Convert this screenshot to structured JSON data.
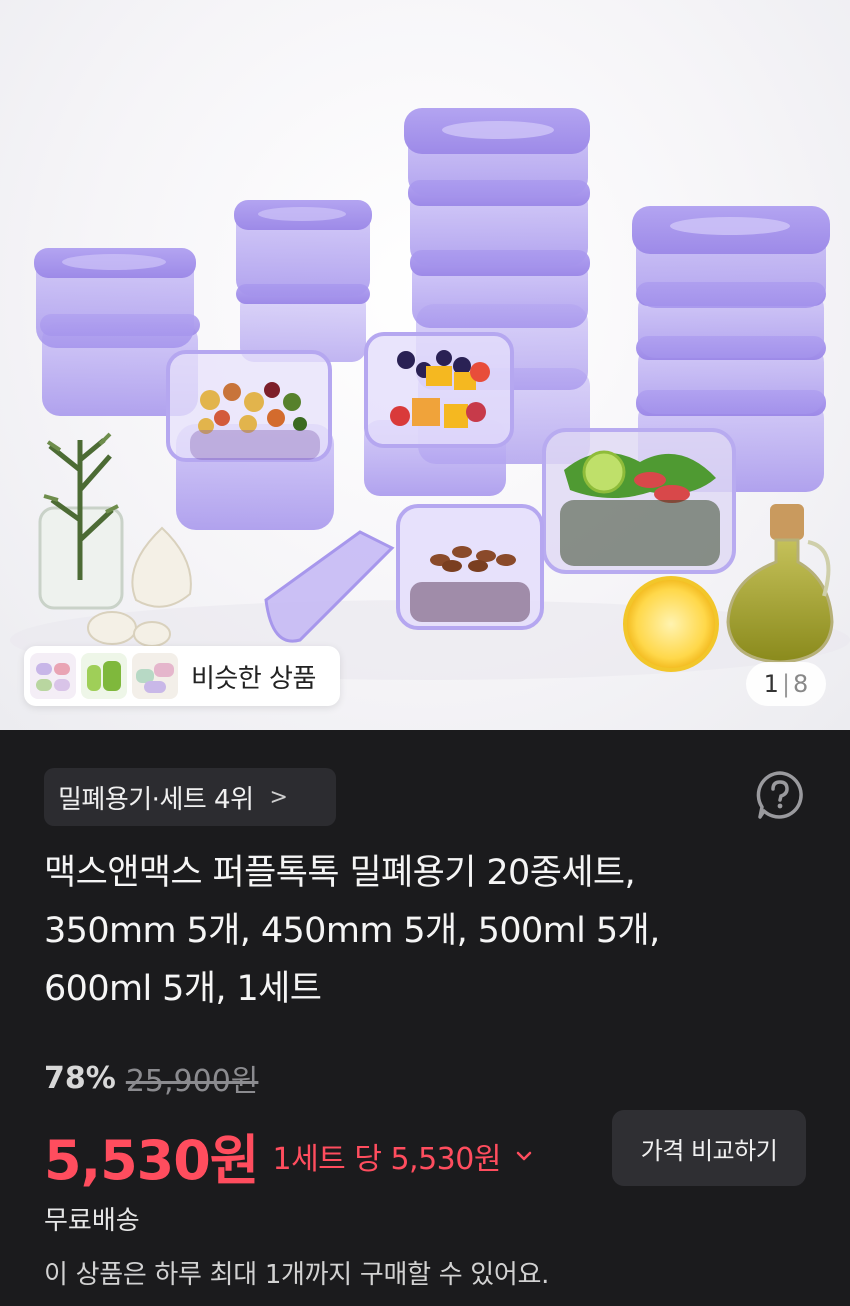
{
  "product_image": {
    "alt": "맥스앤맥스 퍼플톡톡 밀폐용기 20종세트",
    "similar_products": {
      "label": "비슷한 상품",
      "thumbnails": [
        "similar-product-1",
        "similar-product-2",
        "similar-product-3"
      ]
    },
    "page_counter": {
      "current": "1",
      "total": "8"
    }
  },
  "ranking": {
    "label": "밀폐용기·세트 4위",
    "chevron": ">"
  },
  "help_icon": "question-mark-icon",
  "product": {
    "title_lines": [
      "맥스앤맥스 퍼플톡톡 밀폐용기 20종세트,",
      "350mm 5개, 450mm 5개, 500ml 5개,",
      "600ml 5개, 1세트"
    ]
  },
  "pricing": {
    "discount_rate": "78%",
    "original_price": "25,900원",
    "sale_price": "5,530원",
    "unit_price": "1세트 당 5,530원",
    "compare_button": "가격 비교하기"
  },
  "shipping": "무료배송",
  "purchase_limit": "이 상품은 하루 최대 1개까지 구매할 수 있어요.",
  "colors": {
    "background": "#1b1b1d",
    "price_red": "#ff4d5e",
    "chip_bg": "#2c2c30",
    "container_purple": "#b9acf2"
  }
}
